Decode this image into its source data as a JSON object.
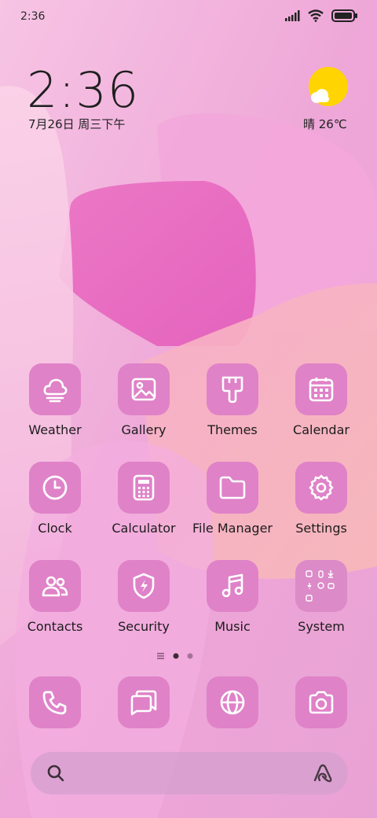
{
  "status_bar": {
    "time": "2:36",
    "icons": [
      "signal-icon",
      "wifi-icon",
      "battery-icon"
    ]
  },
  "clock_widget": {
    "time": "2:36",
    "date": "7月26日 周三下午"
  },
  "weather_widget": {
    "icon": "sun-cloud-icon",
    "text": "晴 26℃"
  },
  "apps": [
    {
      "label": "Weather",
      "icon": "weather-icon"
    },
    {
      "label": "Gallery",
      "icon": "gallery-icon"
    },
    {
      "label": "Themes",
      "icon": "themes-icon"
    },
    {
      "label": "Calendar",
      "icon": "calendar-icon"
    },
    {
      "label": "Clock",
      "icon": "clock-icon"
    },
    {
      "label": "Calculator",
      "icon": "calculator-icon"
    },
    {
      "label": "File Manager",
      "icon": "folder-icon"
    },
    {
      "label": "Settings",
      "icon": "gear-icon"
    },
    {
      "label": "Contacts",
      "icon": "contacts-icon"
    },
    {
      "label": "Security",
      "icon": "security-icon"
    },
    {
      "label": "Music",
      "icon": "music-icon"
    },
    {
      "label": "System",
      "icon": "system-folder-icon"
    }
  ],
  "page_indicator": {
    "pages": 2,
    "current": 1
  },
  "dock": [
    {
      "icon": "phone-icon"
    },
    {
      "icon": "messages-icon"
    },
    {
      "icon": "browser-icon"
    },
    {
      "icon": "camera-icon"
    }
  ],
  "search_bar": {
    "left_icon": "search-icon",
    "right_icon": "assistant-icon"
  },
  "colors": {
    "tile": "#df82c8",
    "text": "#1c1c1c",
    "sun": "#ffd400"
  }
}
